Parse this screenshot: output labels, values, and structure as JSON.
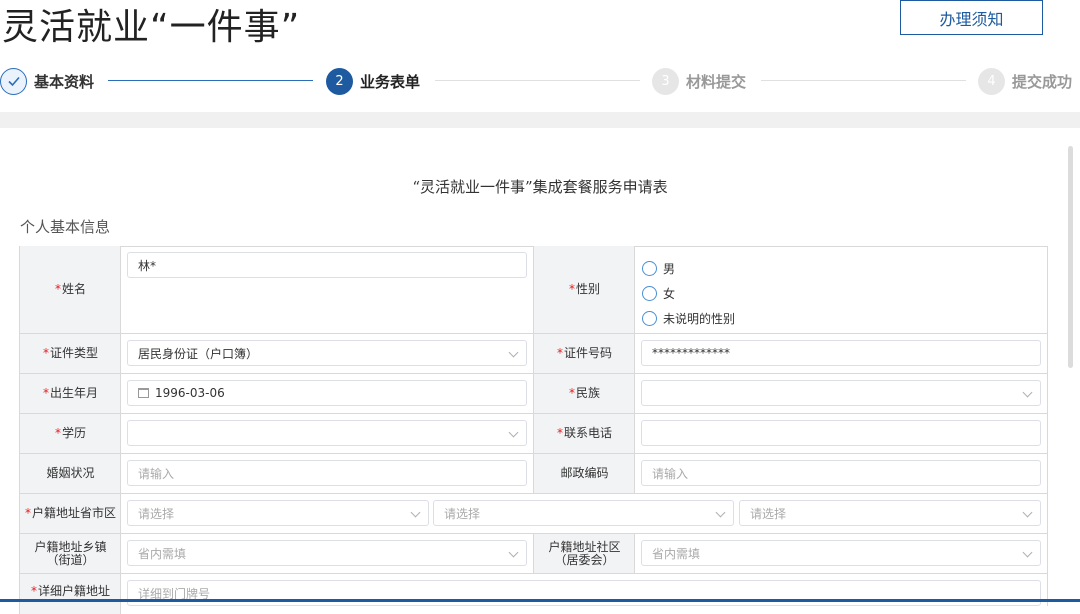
{
  "header": {
    "title": "灵活就业“一件事”",
    "notice_button": "办理须知"
  },
  "steps": [
    {
      "num": "",
      "label": "基本资料",
      "state": "done"
    },
    {
      "num": "2",
      "label": "业务表单",
      "state": "active"
    },
    {
      "num": "3",
      "label": "材料提交",
      "state": "todo"
    },
    {
      "num": "4",
      "label": "提交成功",
      "state": "todo"
    }
  ],
  "form": {
    "title": "“灵活就业一件事”集成套餐服务申请表",
    "section": "个人基本信息"
  },
  "fields": {
    "name": {
      "label": "姓名",
      "value": "林*"
    },
    "gender": {
      "label": "性别",
      "options": [
        "男",
        "女",
        "未说明的性别"
      ]
    },
    "id_type": {
      "label": "证件类型",
      "value": "居民身份证（户口簿）"
    },
    "id_number": {
      "label": "证件号码",
      "value": "*************"
    },
    "birth": {
      "label": "出生年月",
      "value": "1996-03-06"
    },
    "ethnicity": {
      "label": "民族",
      "value": ""
    },
    "education": {
      "label": "学历",
      "value": ""
    },
    "phone": {
      "label": "联系电话",
      "value": ""
    },
    "marital": {
      "label": "婚姻状况",
      "placeholder": "请输入"
    },
    "postcode": {
      "label": "邮政编码",
      "placeholder": "请输入"
    },
    "hukou_region": {
      "label": "户籍地址省市区",
      "placeholders": [
        "请选择",
        "请选择",
        "请选择"
      ]
    },
    "hukou_town": {
      "label_line1": "户籍地址乡镇",
      "label_line2": "（街道）",
      "placeholder": "省内需填"
    },
    "hukou_community": {
      "label_line1": "户籍地址社区",
      "label_line2": "（居委会）",
      "placeholder": "省内需填"
    },
    "hukou_detail": {
      "label": "详细户籍地址",
      "placeholder": "详细到门牌号"
    }
  },
  "colors": {
    "primary": "#1e5aa0",
    "required": "#e02020",
    "label_bg": "#f2f3f5"
  }
}
